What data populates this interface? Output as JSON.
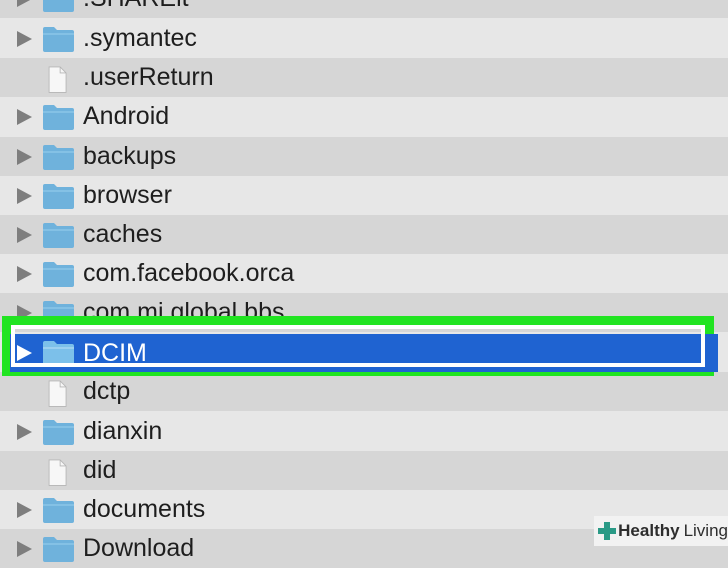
{
  "colors": {
    "background": "#e7e7e7",
    "row_alt": "#d6d6d6",
    "selection": "#1f63d1",
    "highlight_border": "#21e421",
    "folder_blue": "#6fb2dc"
  },
  "files": [
    {
      "name": ".SHAREit",
      "kind": "folder"
    },
    {
      "name": ".symantec",
      "kind": "folder"
    },
    {
      "name": ".userReturn",
      "kind": "file"
    },
    {
      "name": "Android",
      "kind": "folder"
    },
    {
      "name": "backups",
      "kind": "folder"
    },
    {
      "name": "browser",
      "kind": "folder"
    },
    {
      "name": "caches",
      "kind": "folder"
    },
    {
      "name": "com.facebook.orca",
      "kind": "folder"
    },
    {
      "name": "com.mi.global.bbs",
      "kind": "folder"
    },
    {
      "name": "DCIM",
      "kind": "folder",
      "selected": true
    },
    {
      "name": "dctp",
      "kind": "file"
    },
    {
      "name": "dianxin",
      "kind": "folder"
    },
    {
      "name": "did",
      "kind": "file"
    },
    {
      "name": "documents",
      "kind": "folder"
    },
    {
      "name": "Download",
      "kind": "folder"
    }
  ],
  "watermark": {
    "brand": "Healthy",
    "brand_suffix": "Living"
  }
}
